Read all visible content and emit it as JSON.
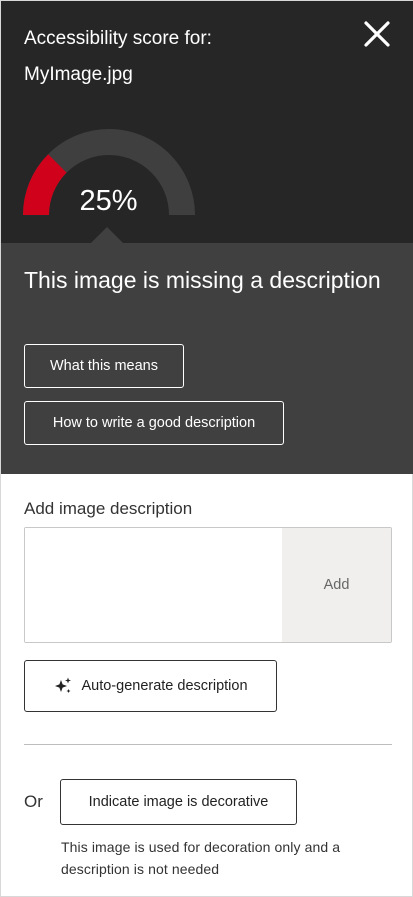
{
  "header": {
    "score_title": "Accessibility score for:",
    "filename": "MyImage.jpg",
    "close_icon": "close-icon",
    "score_value": "25%",
    "score_percent": 25,
    "colors": {
      "filled": "#d0021b",
      "track": "#3f3f3f",
      "background": "#262626"
    }
  },
  "missing": {
    "title": "This image is missing a description",
    "what_means_label": "What this means",
    "how_to_label": "How to write a good description"
  },
  "description": {
    "label": "Add image description",
    "input_value": "",
    "add_label": "Add",
    "auto_generate_label": "Auto-generate description",
    "auto_generate_icon": "sparkle-icon"
  },
  "decorative": {
    "or_label": "Or",
    "button_label": "Indicate image is decorative",
    "note": "This image is used for decoration only and a description is not needed"
  }
}
